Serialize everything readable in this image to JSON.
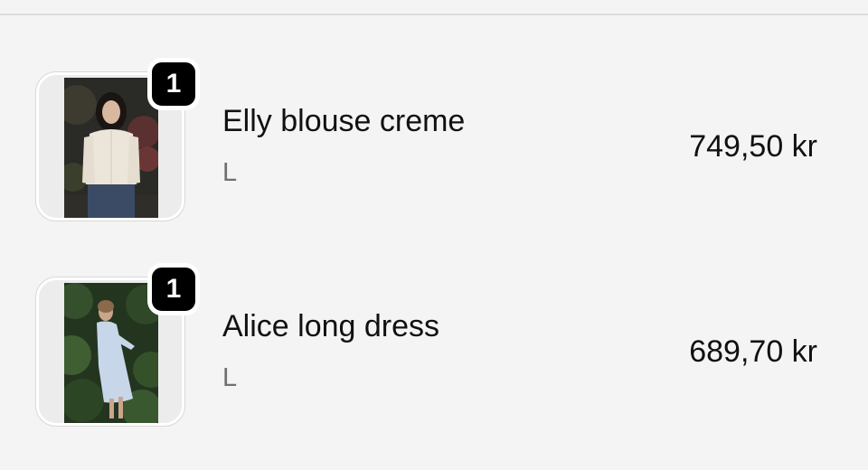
{
  "cart": {
    "items": [
      {
        "title": "Elly blouse creme",
        "variant": "L",
        "quantity": "1",
        "price": "749,50 kr",
        "image_alt": "Elly blouse creme"
      },
      {
        "title": "Alice long dress",
        "variant": "L",
        "quantity": "1",
        "price": "689,70 kr",
        "image_alt": "Alice long dress"
      }
    ]
  },
  "colors": {
    "background": "#f4f4f4",
    "badge": "#000000",
    "text": "#111111",
    "muted_text": "#707070"
  }
}
